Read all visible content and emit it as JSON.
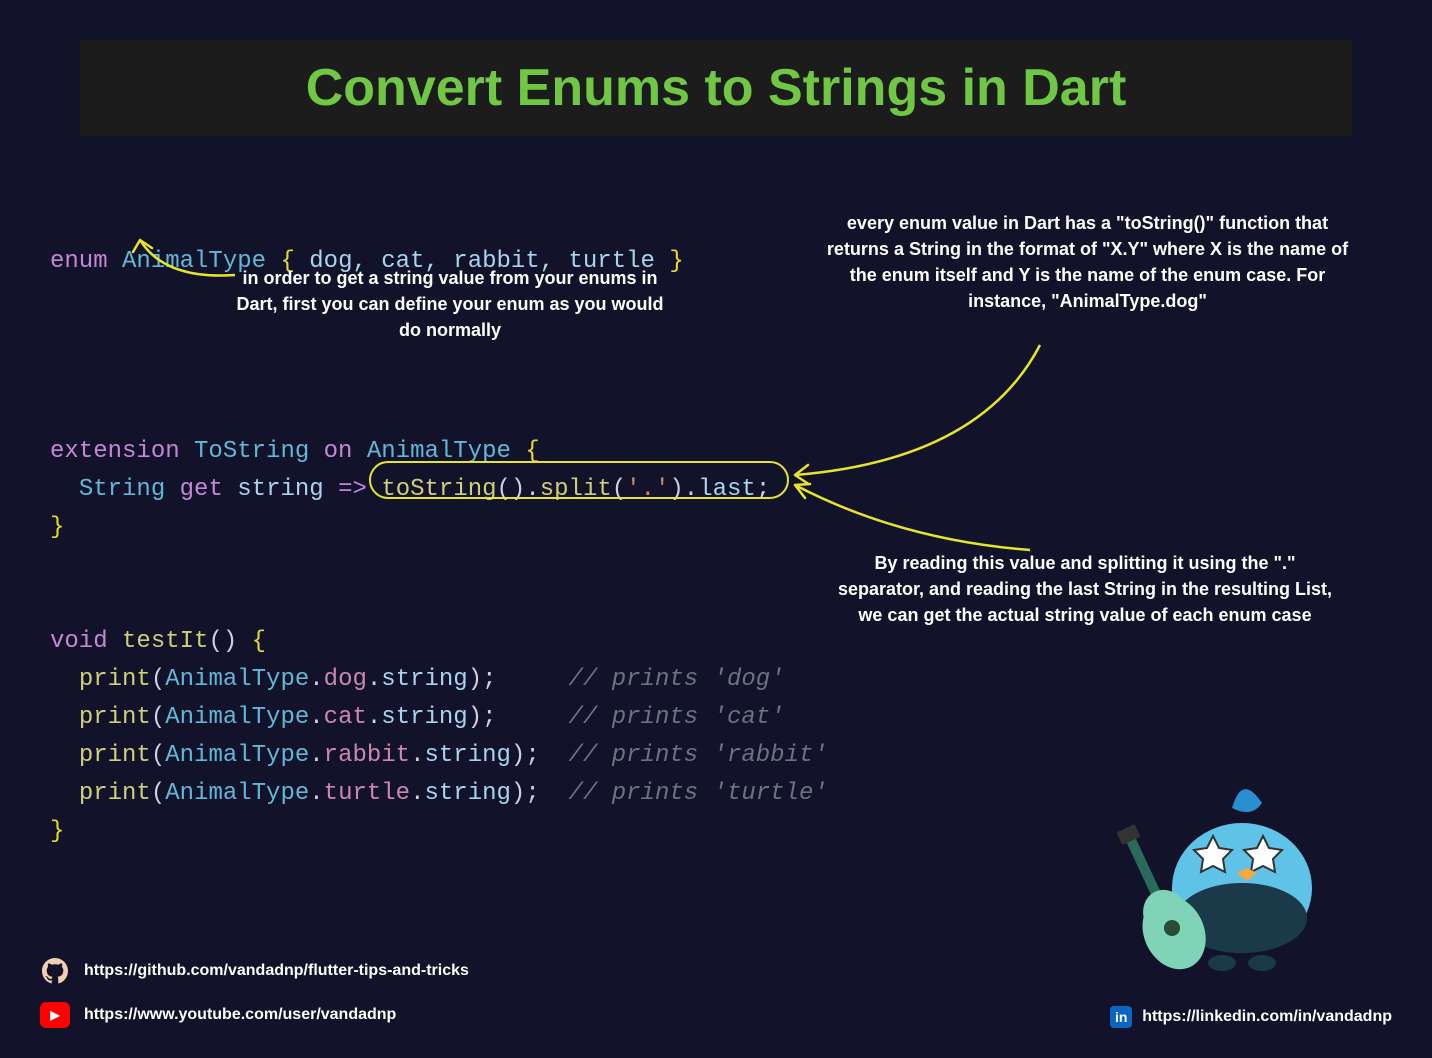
{
  "title": "Convert Enums to Strings in Dart",
  "code": {
    "enum_kw": "enum",
    "enum_name": "AnimalType",
    "brace_open": "{",
    "enum_vals": " dog, cat, rabbit, turtle ",
    "brace_close": "}",
    "ext_kw": "extension",
    "ext_name": "ToString",
    "on_kw": "on",
    "ext_target": "AnimalType",
    "string_type": "String",
    "get_kw": "get",
    "string_name": "string",
    "arrow": "=>",
    "tostring": "toString",
    "split": "split",
    "split_arg": "'.'",
    "last": "last",
    "void_kw": "void",
    "test_name": "testIt",
    "print": "print",
    "animal_type": "AnimalType",
    "dot": ".",
    "dog": "dog",
    "cat": "cat",
    "rabbit": "rabbit",
    "turtle": "turtle",
    "string_prop": "string",
    "c_dog": "// prints 'dog'",
    "c_cat": "// prints 'cat'",
    "c_rabbit": "// prints 'rabbit'",
    "c_turtle": "// prints 'turtle'"
  },
  "annotations": {
    "a1": "in order to get a string value from your enums in Dart, first you can define your enum as you would do normally",
    "a2": "every enum value in Dart has a \"toString()\" function that returns a String in the format of \"X.Y\" where X is the name of the enum itself and Y is the name of the enum case. For instance, \"AnimalType.dog\"",
    "a3": "By reading this value and splitting it using the \".\" separator, and reading the last String in the resulting List, we can get the actual string value of each enum case"
  },
  "links": {
    "github": "https://github.com/vandadnp/flutter-tips-and-tricks",
    "youtube": "https://www.youtube.com/user/vandadnp",
    "linkedin": "https://linkedin.com/in/vandadnp"
  }
}
